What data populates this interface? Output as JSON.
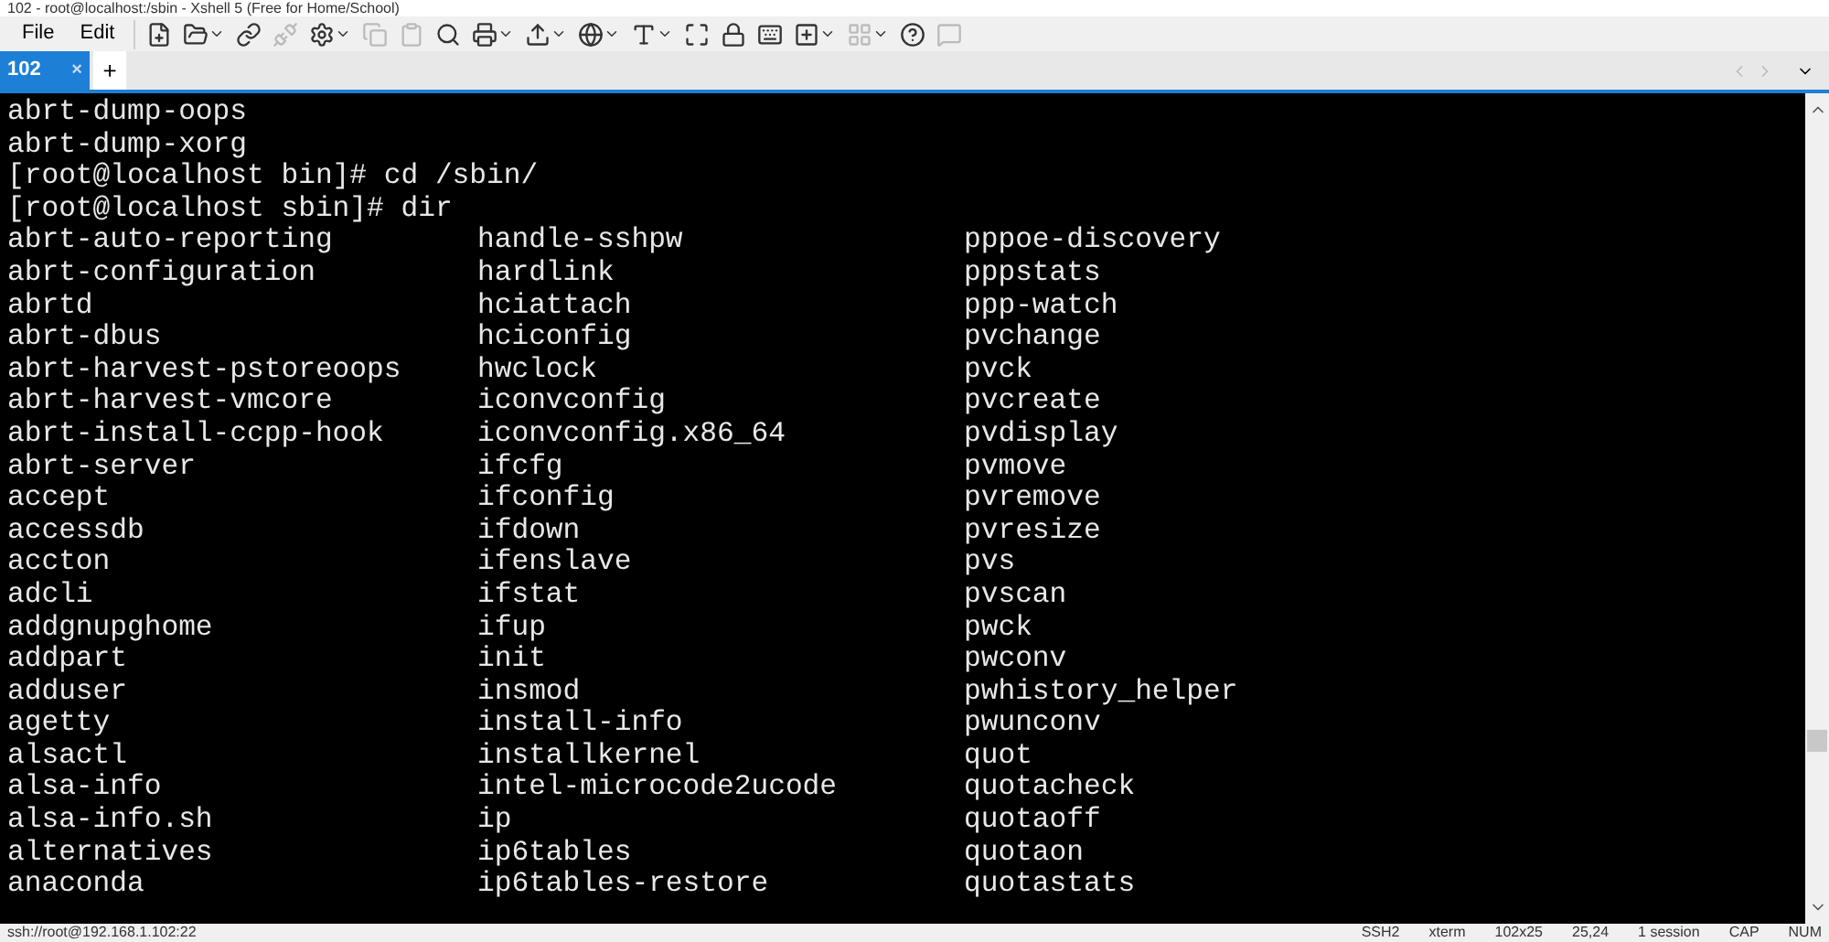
{
  "window": {
    "title": "102 - root@localhost:/sbin - Xshell 5 (Free for Home/School)"
  },
  "menu": [
    "File",
    "Edit"
  ],
  "tabs": [
    {
      "label": "102",
      "selected": true,
      "close": "×"
    },
    {
      "label": "+",
      "selected": false
    }
  ],
  "terminal": {
    "lines": [
      "abrt-dump-oops",
      "abrt-dump-xorg",
      "[root@localhost bin]# cd /sbin/",
      "[root@localhost sbin]# dir"
    ],
    "listing": [
      [
        "abrt-auto-reporting",
        "handle-sshpw",
        "pppoe-discovery"
      ],
      [
        "abrt-configuration",
        "hardlink",
        "pppstats"
      ],
      [
        "abrtd",
        "hciattach",
        "ppp-watch"
      ],
      [
        "abrt-dbus",
        "hciconfig",
        "pvchange"
      ],
      [
        "abrt-harvest-pstoreoops",
        "hwclock",
        "pvck"
      ],
      [
        "abrt-harvest-vmcore",
        "iconvconfig",
        "pvcreate"
      ],
      [
        "abrt-install-ccpp-hook",
        "iconvconfig.x86_64",
        "pvdisplay"
      ],
      [
        "abrt-server",
        "ifcfg",
        "pvmove"
      ],
      [
        "accept",
        "ifconfig",
        "pvremove"
      ],
      [
        "accessdb",
        "ifdown",
        "pvresize"
      ],
      [
        "accton",
        "ifenslave",
        "pvs"
      ],
      [
        "adcli",
        "ifstat",
        "pvscan"
      ],
      [
        "addgnupghome",
        "ifup",
        "pwck"
      ],
      [
        "addpart",
        "init",
        "pwconv"
      ],
      [
        "adduser",
        "insmod",
        "pwhistory_helper"
      ],
      [
        "agetty",
        "install-info",
        "pwunconv"
      ],
      [
        "alsactl",
        "installkernel",
        "quot"
      ],
      [
        "alsa-info",
        "intel-microcode2ucode",
        "quotacheck"
      ],
      [
        "alsa-info.sh",
        "ip",
        "quotaoff"
      ],
      [
        "alternatives",
        "ip6tables",
        "quotaon"
      ],
      [
        "anaconda",
        "ip6tables-restore",
        "quotastats"
      ]
    ]
  },
  "status_bar": {
    "address": "ssh://root@192.168.1.102:22",
    "items": [
      "SSH2",
      "xterm",
      "102x25",
      "25,24",
      "1 session",
      "CAP",
      "NUM"
    ]
  }
}
